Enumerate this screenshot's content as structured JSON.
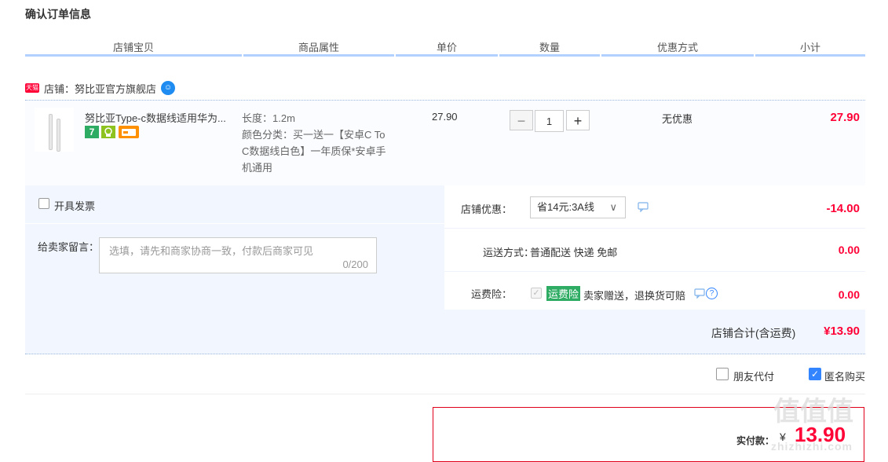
{
  "page_title": "确认订单信息",
  "columns": [
    "店铺宝贝",
    "商品属性",
    "单价",
    "数量",
    "优惠方式",
    "小计"
  ],
  "shop": {
    "tmall_badge": "天猫",
    "label": "店铺：努比亚官方旗舰店"
  },
  "item": {
    "name": "努比亚Type-c数据线适用华为...",
    "badges": [
      "7",
      "qualified-icon",
      "card-icon"
    ],
    "attr_length": "长度：1.2m",
    "attr_color_lines": [
      "颜色分类：买一送一【安卓C To",
      "C数据线白色】一年质保*安卓手",
      "机通用"
    ],
    "unit_price": "27.90",
    "quantity": "1",
    "minus": "−",
    "plus": "+",
    "promo": "无优惠",
    "subtotal": "27.90"
  },
  "invoice_label": "开具发票",
  "message": {
    "label": "给卖家留言：",
    "placeholder": "选填，请先和商家协商一致，付款后商家可见",
    "counter": "0/200"
  },
  "shop_discount": {
    "label": "店铺优惠：",
    "selected": "省14元:3A线",
    "amount": "-14.00"
  },
  "shipping": {
    "label": "运送方式：",
    "value": "普通配送 快递 免邮",
    "amount": "0.00"
  },
  "insurance": {
    "label": "运费险：",
    "tag": "运费险",
    "desc": "卖家赠送，退换货可赔",
    "amount": "0.00"
  },
  "shop_total": {
    "label": "店铺合计(含运费)",
    "value": "¥13.90"
  },
  "options": {
    "friend_pay": "朋友代付",
    "anonymous": "匿名购买"
  },
  "final": {
    "label": "实付款：",
    "currency": "¥",
    "value": "13.90"
  },
  "watermark": {
    "logo": "值值值",
    "site": "zhizhizhi.com"
  },
  "colors": {
    "accent_red": "#ff0036",
    "header_line": "#b2d1ff",
    "panel_bg": "#f2f7ff",
    "checkbox_blue": "#3385ff",
    "tag_green": "#2eac63"
  }
}
